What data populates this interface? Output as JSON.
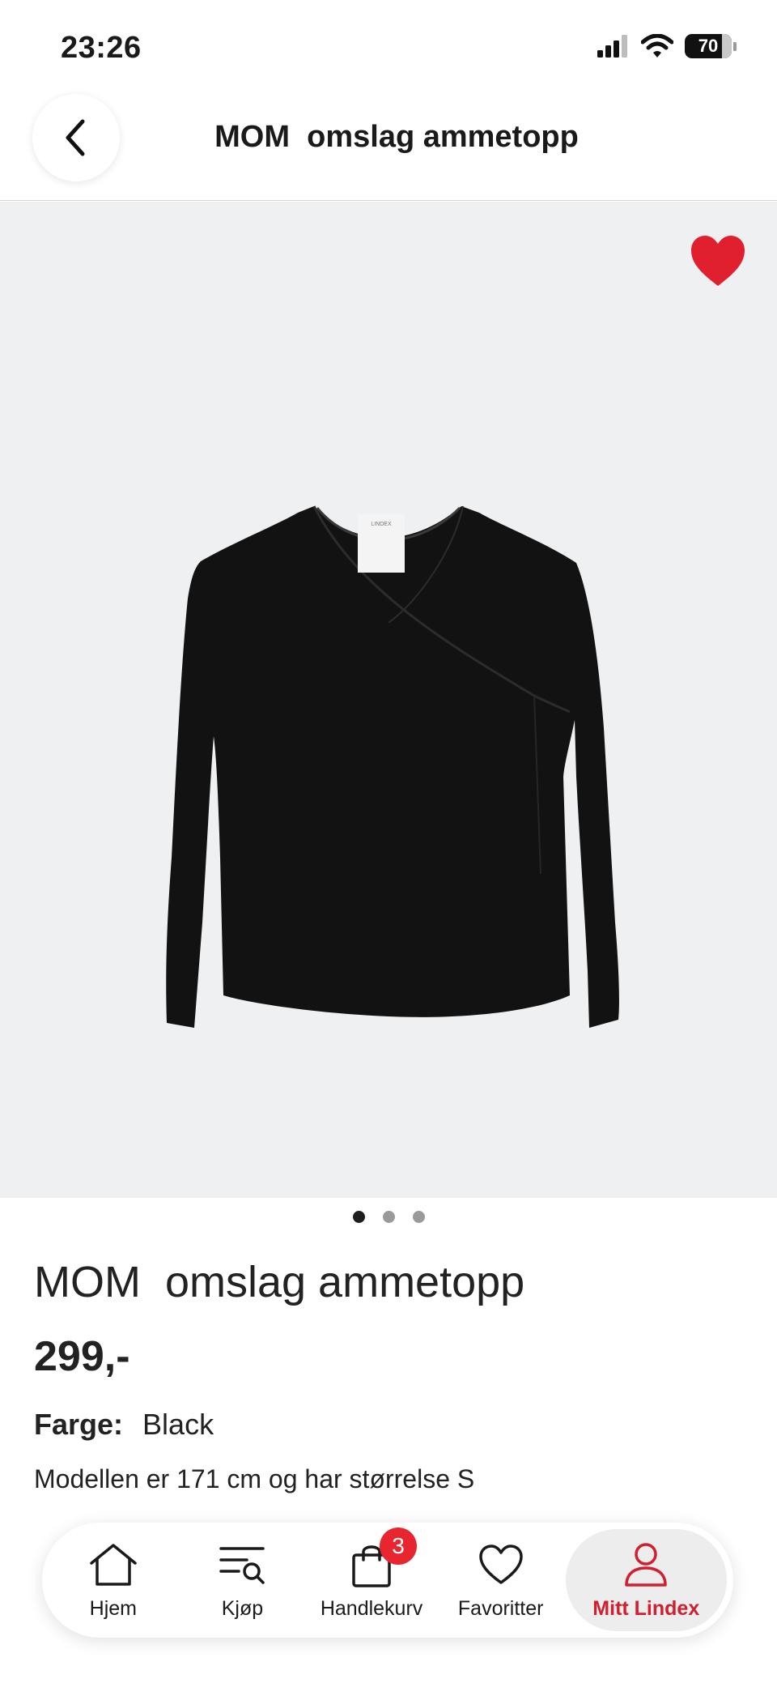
{
  "status_bar": {
    "time": "23:26",
    "battery": "70"
  },
  "header": {
    "title": "MOM  omslag ammetopp"
  },
  "gallery": {
    "image_count": 3,
    "active_index": 0
  },
  "product": {
    "name": "MOM  omslag ammetopp",
    "price": "299,-",
    "color_label": "Farge:",
    "color_value": "Black",
    "model_info": "Modellen er 171 cm og har størrelse S",
    "tag_text": "LINDEX"
  },
  "bottom_nav": {
    "items": [
      {
        "label": "Hjem",
        "icon": "home-icon"
      },
      {
        "label": "Kjøp",
        "icon": "search-list-icon"
      },
      {
        "label": "Handlekurv",
        "icon": "shopping-bag-icon",
        "badge": "3"
      },
      {
        "label": "Favoritter",
        "icon": "heart-outline-icon"
      },
      {
        "label": "Mitt Lindex",
        "icon": "user-icon",
        "active": true
      }
    ]
  },
  "colors": {
    "accent": "#d0202f",
    "badge": "#e8262f",
    "favorite": "#e0202f"
  }
}
